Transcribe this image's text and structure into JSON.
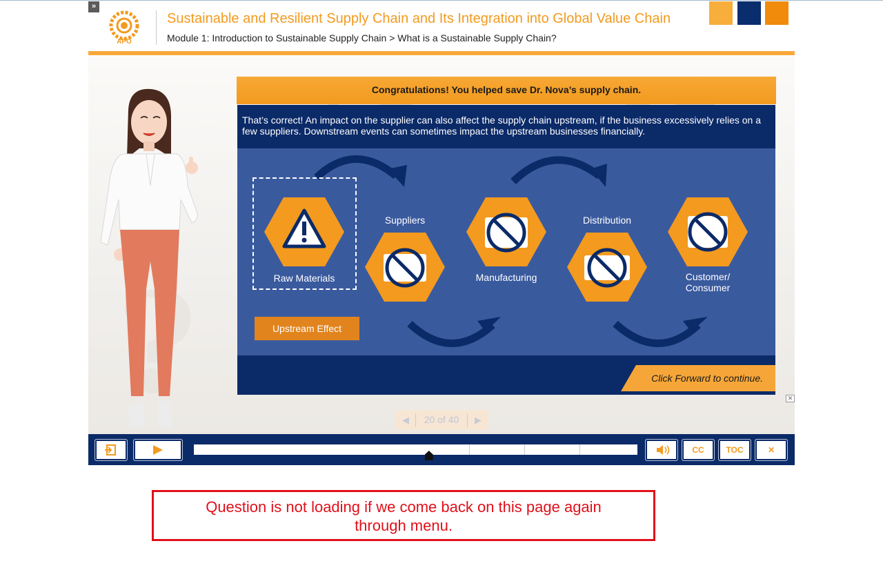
{
  "header": {
    "expand_icon": "double-chevron-right-icon",
    "logo_text": "APO",
    "course_title": "Sustainable and Resilient Supply Chain and Its Integration into Global Value Chain",
    "breadcrumb": "Module 1: Introduction to Sustainable Supply Chain > What is a Sustainable Supply Chain?",
    "accent_colors": [
      "#f8ae3a",
      "#0a2d6e",
      "#f08b0c"
    ]
  },
  "slide": {
    "congrats": "Congratulations! You helped save Dr. Nova’s supply chain.",
    "feedback": "That’s correct! An impact on the supplier can also affect the supply chain upstream, if the business excessively relies on a few suppliers. Downstream events can sometimes impact the upstream businesses financially.",
    "nodes": [
      {
        "label": "Raw Materials",
        "icon": "warning-icon"
      },
      {
        "label": "Suppliers",
        "icon": "forklift-prohibited-icon"
      },
      {
        "label": "Manufacturing",
        "icon": "factory-prohibited-icon"
      },
      {
        "label": "Distribution",
        "icon": "truck-prohibited-icon"
      },
      {
        "label": "Customer/ Consumer",
        "icon": "store-prohibited-icon"
      }
    ],
    "customer_line1": "Customer/",
    "customer_line2": "Consumer",
    "upstream_button": "Upstream Effect",
    "click_forward": "Click Forward to continue."
  },
  "pager": {
    "text": "20 of 40",
    "current": 20,
    "total": 40
  },
  "controls": {
    "exit_icon": "exit-icon",
    "play_icon": "play-icon",
    "progress": 0.53,
    "volume_icon": "volume-icon",
    "cc_label": "CC",
    "toc_label": "TOC",
    "close_icon": "close-icon"
  },
  "annotation": {
    "note_line1": "Question is not loading if we come back on this page again",
    "note_line2": "through menu."
  },
  "colors": {
    "orange": "#f39a1f",
    "navy": "#0b2a68",
    "diagram_blue": "#3a5a9e",
    "note_red": "#e0101a"
  }
}
